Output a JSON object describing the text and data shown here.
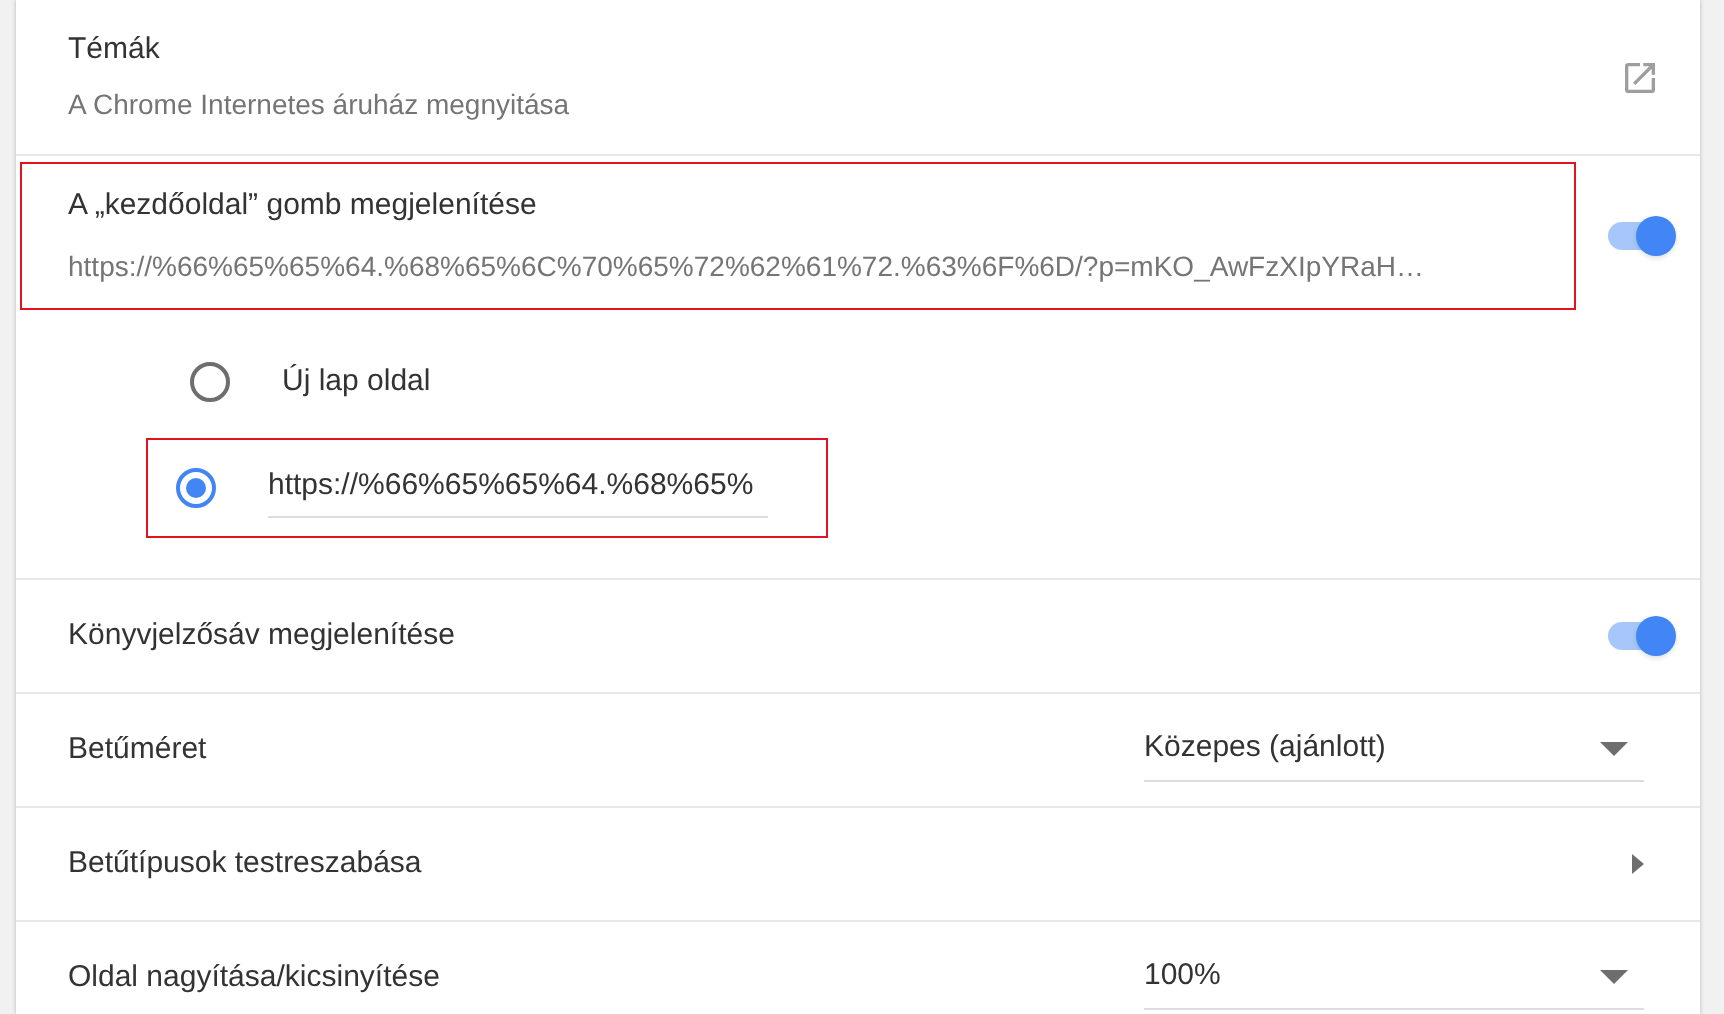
{
  "themes": {
    "title": "Témák",
    "subtitle": "A Chrome Internetes áruház megnyitása"
  },
  "home_button": {
    "title": "A „kezdőoldal” gomb megjelenítése",
    "url": "https://%66%65%65%64.%68%65%6C%70%65%72%62%61%72.%63%6F%6D/?p=mKO_AwFzXIpYRaH…",
    "on": true,
    "options": [
      {
        "kind": "label",
        "label": "Új lap oldal",
        "selected": false
      },
      {
        "kind": "field",
        "value": "https://%66%65%65%64.%68%65%",
        "selected": true
      }
    ]
  },
  "rows": [
    {
      "kind": "toggle",
      "label": "Könyvjelzősáv megjelenítése",
      "on": true
    },
    {
      "kind": "dropdown",
      "label": "Betűméret",
      "value": "Közepes (ajánlott)"
    },
    {
      "kind": "link",
      "label": "Betűtípusok testreszabása"
    },
    {
      "kind": "dropdown",
      "label": "Oldal nagyítása/kicsinyítése",
      "value": "100%"
    }
  ]
}
